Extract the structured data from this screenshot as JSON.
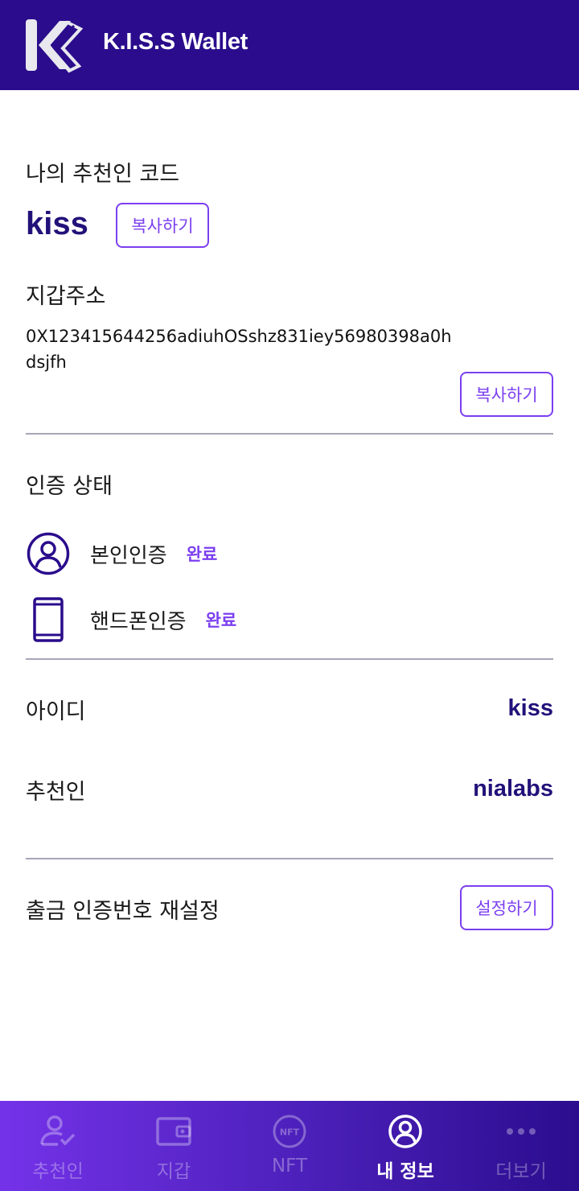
{
  "header": {
    "app_title": "K.I.S.S Wallet",
    "colors": {
      "background": "#2a0c8c",
      "text": "#ffffff"
    }
  },
  "referral": {
    "label": "나의 추천인 코드",
    "code": "kiss",
    "copy_button": "복사하기"
  },
  "wallet": {
    "label": "지갑주소",
    "address": "0X123415644256adiuhOSshz831iey56980398a0hdsjfh",
    "copy_button": "복사하기"
  },
  "verification": {
    "title": "인증 상태",
    "items": [
      {
        "icon": "user-circle-icon",
        "label": "본인인증",
        "status": "완료"
      },
      {
        "icon": "phone-icon",
        "label": "핸드폰인증",
        "status": "완료"
      }
    ]
  },
  "account": {
    "id_label": "아이디",
    "id_value": "kiss",
    "referrer_label": "추천인",
    "referrer_value": "nialabs"
  },
  "withdraw_pin": {
    "label": "출금 인증번호 재설정",
    "button": "설정하기"
  },
  "bottom_nav": {
    "items": [
      {
        "icon": "user-check-icon",
        "label": "추천인",
        "active": false
      },
      {
        "icon": "wallet-icon",
        "label": "지갑",
        "active": false
      },
      {
        "icon": "nft-icon",
        "label": "NFT",
        "active": false
      },
      {
        "icon": "user-circle-icon",
        "label": "내 정보",
        "active": true
      },
      {
        "icon": "more-dots-icon",
        "label": "더보기",
        "active": false
      }
    ]
  },
  "colors": {
    "accent": "#7b3ff0",
    "value_text": "#23117a",
    "divider": "#a8a6b8"
  }
}
